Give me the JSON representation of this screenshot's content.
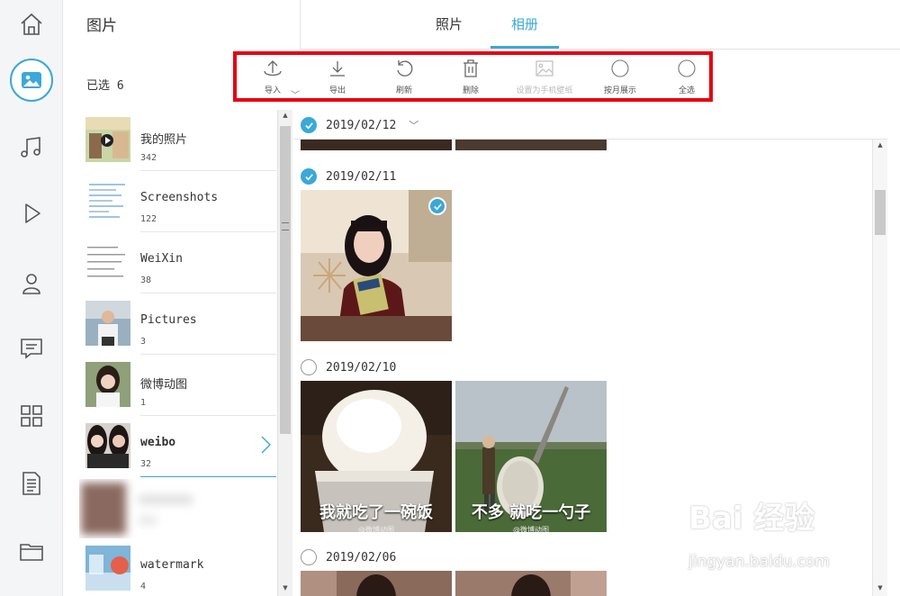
{
  "header": {
    "title": "图片",
    "tabs": [
      {
        "label": "照片",
        "active": false
      },
      {
        "label": "相册",
        "active": true
      }
    ],
    "selected_count": "已选 6"
  },
  "nav": [
    {
      "icon": "home-icon"
    },
    {
      "icon": "photos-icon",
      "active": true
    },
    {
      "icon": "music-icon"
    },
    {
      "icon": "video-icon"
    },
    {
      "icon": "contacts-icon"
    },
    {
      "icon": "messages-icon"
    },
    {
      "icon": "apps-icon"
    },
    {
      "icon": "document-icon"
    },
    {
      "icon": "folder-icon"
    }
  ],
  "toolbar": {
    "import": "导入",
    "export": "导出",
    "refresh": "刷新",
    "delete": "删除",
    "set_wallpaper": "设置为手机壁纸",
    "by_month": "按月展示",
    "select_all": "全选"
  },
  "albums": [
    {
      "name": "我的照片",
      "count": "342"
    },
    {
      "name": "Screenshots",
      "count": "122"
    },
    {
      "name": "WeiXin",
      "count": "38"
    },
    {
      "name": "Pictures",
      "count": "3"
    },
    {
      "name": "微博动图",
      "count": "1"
    },
    {
      "name": "weibo",
      "count": "32",
      "selected": true
    },
    {
      "name": "watermark",
      "count": "4"
    }
  ],
  "groups": [
    {
      "date": "2019/02/12",
      "checked": true
    },
    {
      "date": "2019/02/11",
      "checked": true
    },
    {
      "date": "2019/02/10",
      "checked": false
    },
    {
      "date": "2019/02/06",
      "checked": false
    }
  ],
  "photos": {
    "rice_caption": "我就吃了一碗饭",
    "spoon_caption": "不多 就吃一勺子",
    "rice_source": "@微博动图",
    "spoon_source": "@微博动图"
  },
  "watermark": {
    "brand": "Bai 经验",
    "url": "jingyan.baidu.com"
  },
  "colors": {
    "accent": "#3aa8d8",
    "highlight_border": "#e60012"
  }
}
